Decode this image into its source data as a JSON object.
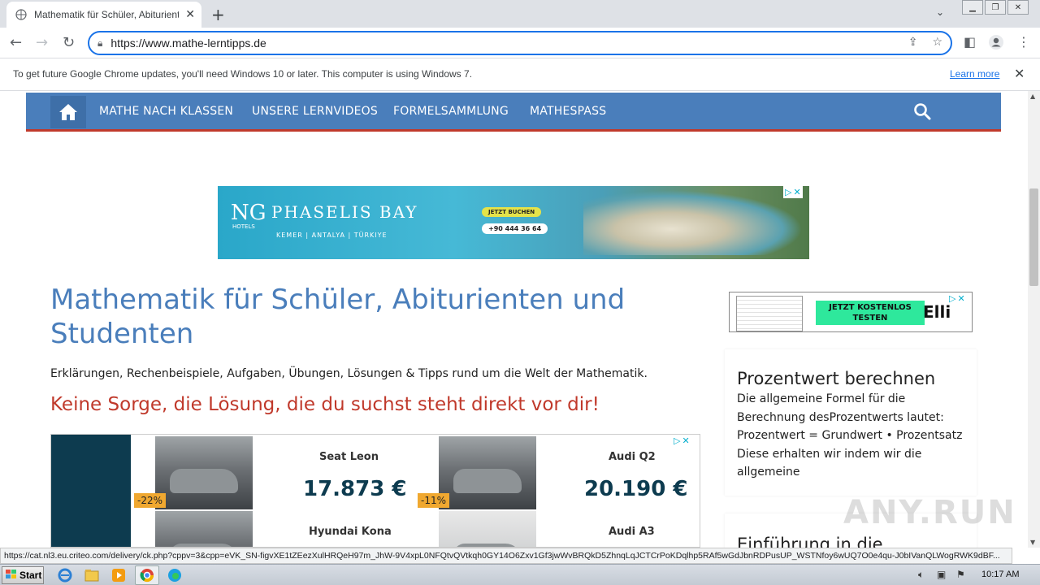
{
  "browser": {
    "tab_title": "Mathematik für Schüler, Abiturienten",
    "url": "https://www.mathe-lerntipps.de",
    "infobar_message": "To get future Google Chrome updates, you'll need Windows 10 or later. This computer is using Windows 7.",
    "infobar_link": "Learn more",
    "status_url": "https://cat.nl3.eu.criteo.com/delivery/ck.php?cppv=3&cpp=eVK_SN-figvXE1tZEezXulHRQeH97m_JhW-9V4xpL0NFQtvQVtkqh0GY14O6Zxv1Gf3jwWvBRQkD5ZhnqLqJCTCrPoKDqlhp5RAf5wGdJbnRDPusUP_WSTNfoy6wUQ7O0e4qu-J0bIVanQLWogRWK9dBF..."
  },
  "nav": {
    "items": [
      "MATHE NACH KLASSEN",
      "UNSERE LERNVIDEOS",
      "FORMELSAMMLUNG",
      "MATHESPASS"
    ]
  },
  "ad_banner": {
    "logo": "NG",
    "brand": "PHASELIS BAY",
    "hotels": "HOTELS",
    "locations": "KEMER | ANTALYA | TÜRKIYE",
    "cta": "JETZT BUCHEN",
    "phone": "+90 444 36 64"
  },
  "main": {
    "title": "Mathematik für Schüler, Abiturienten und Studenten",
    "intro": "Erklärungen, Rechenbeispiele, Aufgaben, Übungen, Lösungen & Tipps rund um die Welt der Mathematik.",
    "slogan": "Keine Sorge, die Lösung, die du suchst steht direkt vor dir!"
  },
  "car_ad": {
    "cars": [
      {
        "name": "Seat Leon",
        "price": "17.873 €",
        "discount": "-22%"
      },
      {
        "name": "Audi Q2",
        "price": "20.190 €",
        "discount": "-11%"
      },
      {
        "name": "Hyundai Kona",
        "price": "",
        "discount": ""
      },
      {
        "name": "Audi A3",
        "price": "",
        "discount": ""
      }
    ]
  },
  "side_ad": {
    "cta": "JETZT KOSTENLOS TESTEN",
    "brand": "Elli"
  },
  "sidebar": {
    "widget_title": "Prozentwert berechnen",
    "widget_body": "Die allgemeine Formel für die Berechnung desProzentwerts lautet: Prozentwert = Grundwert • Prozentsatz Diese erhalten wir indem wir die allgemeine",
    "widget2_title": "Einführung in die"
  },
  "watermark": "ANY.RUN",
  "taskbar": {
    "start": "Start",
    "clock": "10:17 AM"
  },
  "colors": {
    "nav_blue": "#4a7ebb",
    "accent_red": "#c0392b",
    "chrome_blue": "#1a73e8"
  }
}
